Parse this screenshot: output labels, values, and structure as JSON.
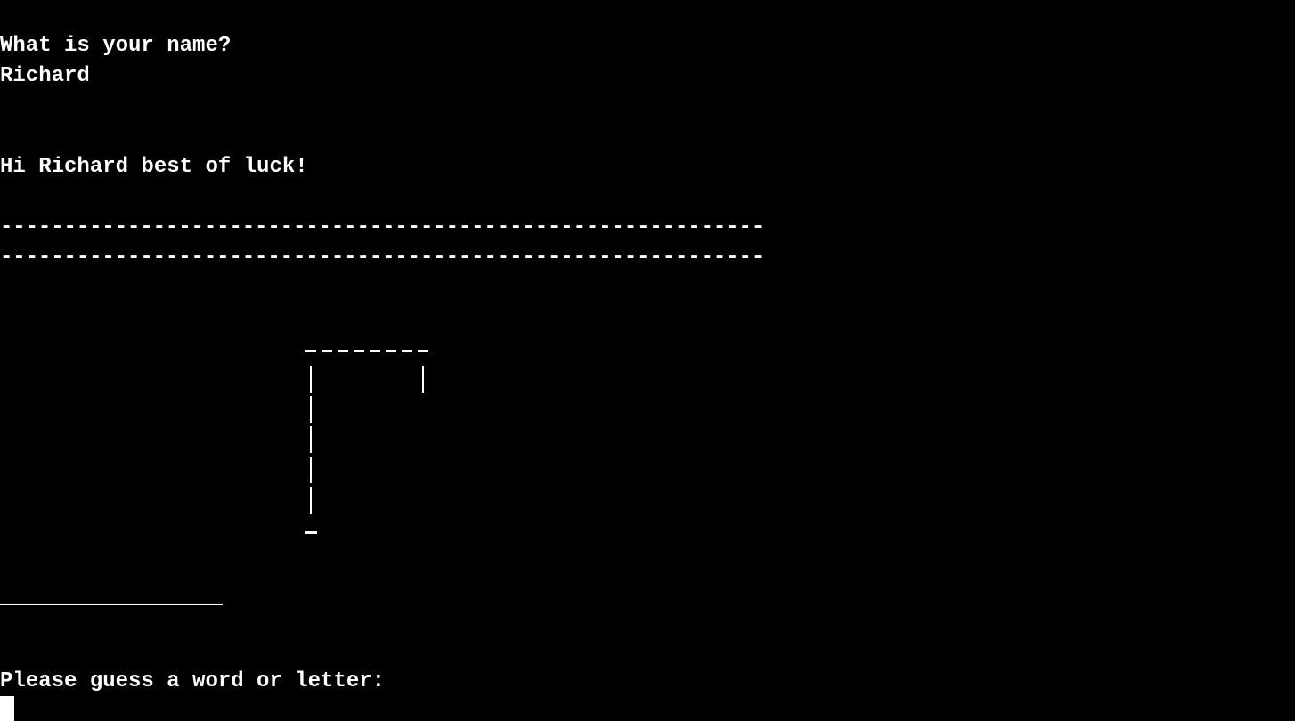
{
  "theme": {
    "background": "#000000",
    "foreground": "#ffffff"
  },
  "terminal": {
    "name_prompt": "What is your name?",
    "name_input": "Richard",
    "greeting": "Hi Richard best of luck!",
    "divider_1": "------------------------------------------------------------",
    "divider_2": "------------------------------------------------------------",
    "gallows": {
      "stage": "empty-gallows",
      "top_beam": "--------",
      "base": "-"
    },
    "word_progress": "",
    "guess_prompt": "Please guess a word or letter:",
    "guess_input": ""
  }
}
